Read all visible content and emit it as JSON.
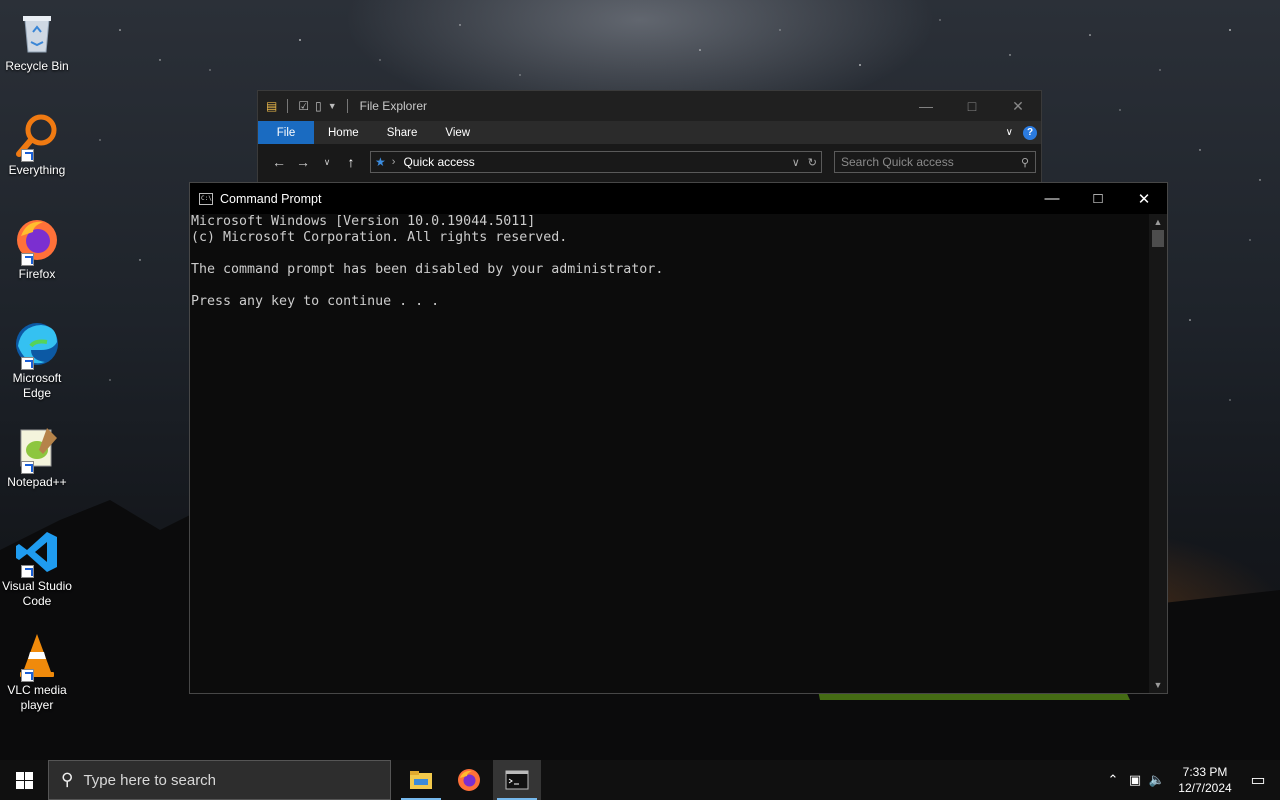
{
  "desktop": {
    "icons": [
      {
        "label": "Recycle Bin"
      },
      {
        "label": "Everything"
      },
      {
        "label": "Firefox"
      },
      {
        "label": "Microsoft Edge"
      },
      {
        "label": "Notepad++"
      },
      {
        "label": "Visual Studio Code"
      },
      {
        "label": "VLC media player"
      }
    ]
  },
  "file_explorer": {
    "title": "File Explorer",
    "tabs": [
      "File",
      "Home",
      "Share",
      "View"
    ],
    "address": "Quick access",
    "search_placeholder": "Search Quick access"
  },
  "cmd": {
    "title": "Command Prompt",
    "lines": [
      "Microsoft Windows [Version 10.0.19044.5011]",
      "(c) Microsoft Corporation. All rights reserved.",
      "",
      "The command prompt has been disabled by your administrator.",
      "",
      "Press any key to continue . . ."
    ]
  },
  "taskbar": {
    "search_placeholder": "Type here to search",
    "time": "7:33 PM",
    "date": "12/7/2024",
    "accent_color": "#76b9ed"
  }
}
